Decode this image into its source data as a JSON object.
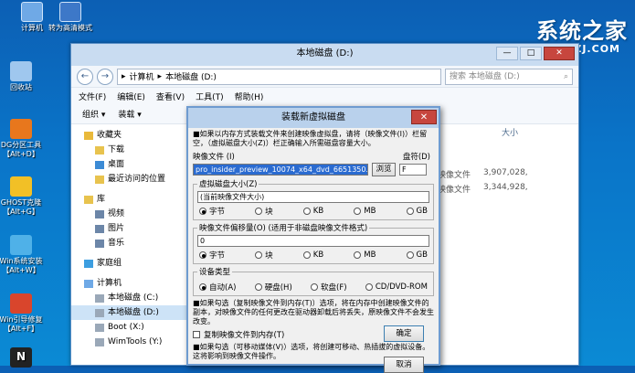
{
  "desktop": {
    "icons": [
      {
        "label": "计算机",
        "color": "#6fa9e6"
      },
      {
        "label": "转为高清模式",
        "color": "#3d78c8"
      },
      {
        "label": "回收站",
        "color": "#9fc7ee"
      },
      {
        "label": "DG分区工具",
        "label2": "【Alt+D】",
        "color": "#e8771d"
      },
      {
        "label": "GHOST克隆",
        "label2": "【Alt+G】",
        "color": "#f2c026"
      },
      {
        "label": "Win系统安装",
        "label2": "【Alt+W】",
        "color": "#4fb1e8"
      },
      {
        "label": "Win引导修复",
        "label2": "【Alt+F】",
        "color": "#d9452c"
      },
      {
        "label": "N",
        "color": "#222222"
      }
    ],
    "watermark": "系统之家",
    "watermark_sub": "KZJ.COM"
  },
  "explorer": {
    "title": "本地磁盘 (D:)",
    "min": "—",
    "max": "□",
    "close": "✕",
    "back": "←",
    "forward": "→",
    "path": [
      "计算机",
      "本地磁盘 (D:)"
    ],
    "sep": "▸",
    "search_placeholder": "搜索 本地磁盘 (D:)",
    "search_icon": "⌕",
    "menu": [
      "文件(F)",
      "编辑(E)",
      "查看(V)",
      "工具(T)",
      "帮助(H)"
    ],
    "toolbar": [
      "组织 ▾",
      "装载 ▾"
    ],
    "nav": [
      {
        "label": "收藏夹",
        "level": 0,
        "icon": "star-icon",
        "color": "#e9b93b"
      },
      {
        "label": "下载",
        "level": 1,
        "icon": "folder-icon",
        "color": "#e8c34e"
      },
      {
        "label": "桌面",
        "level": 1,
        "icon": "folder-icon",
        "color": "#3c8bd5"
      },
      {
        "label": "最近访问的位置",
        "level": 1,
        "icon": "folder-icon",
        "color": "#e8c34e"
      },
      {
        "label": "库",
        "level": 0,
        "icon": "library-icon",
        "color": "#e8c34e"
      },
      {
        "label": "视频",
        "level": 1,
        "icon": "video-icon",
        "color": "#6c86a8"
      },
      {
        "label": "图片",
        "level": 1,
        "icon": "picture-icon",
        "color": "#6c86a8"
      },
      {
        "label": "音乐",
        "level": 1,
        "icon": "music-icon",
        "color": "#6c86a8"
      },
      {
        "label": "家庭组",
        "level": 0,
        "icon": "homegroup-icon",
        "color": "#3d9ee0"
      },
      {
        "label": "计算机",
        "level": 0,
        "icon": "computer-icon",
        "color": "#6fa9e6"
      },
      {
        "label": "本地磁盘 (C:)",
        "level": 1,
        "icon": "drive-icon",
        "color": "#9aa8b8"
      },
      {
        "label": "本地磁盘 (D:)",
        "level": 1,
        "icon": "drive-icon",
        "color": "#9aa8b8",
        "selected": true
      },
      {
        "label": "Boot (X:)",
        "level": 1,
        "icon": "drive-icon",
        "color": "#9aa8b8"
      },
      {
        "label": "WimTools (Y:)",
        "level": 1,
        "icon": "drive-icon",
        "color": "#9aa8b8"
      }
    ],
    "col_size": "大小",
    "rows": [
      {
        "type": "映像文件",
        "size": "3,907,028,"
      },
      {
        "type": "映像文件",
        "size": "3,344,928,"
      }
    ]
  },
  "dialog": {
    "title": "装载新虚拟磁盘",
    "close": "✕",
    "note1": "■如果以内存方式装载文件来创建映像虚拟盘，请将（映像文件(I)）栏留空，（虚拟磁盘大小(Z)）栏正确输入所需磁盘容量大小。",
    "image_file_label": "映像文件 (I)",
    "drive_letter_label": "盘符(D)",
    "image_file_value": "pro_insider_preview_10074_x64_dvd_6651350.iso",
    "browse": "浏览",
    "drive_letter_value": "F",
    "vsize_legend": "虚拟磁盘大小(Z)",
    "vsize_value": "(当前映像文件大小)",
    "units": [
      "字节",
      "块",
      "KB",
      "MB",
      "GB"
    ],
    "vsize_selected": 0,
    "offset_legend": "映像文件偏移量(O) (适用于非磁盘映像文件格式)",
    "offset_value": "0",
    "offset_selected": 0,
    "dtype_legend": "设备类型",
    "dtypes": [
      "自动(A)",
      "硬盘(H)",
      "软盘(F)",
      "CD/DVD-ROM"
    ],
    "dtype_selected": 0,
    "note2": "■如果勾选（复制映像文件到内存(T)）选项，将在内存中创建映像文件的副本，对映像文件的任何更改在驱动器卸载后将丢失，原映像文件不会发生改变。",
    "copy_checkbox": "复制映像文件到内存(T)",
    "note3": "■如果勾选（可移动媒体(V)）选项，将创建可移动、热插拔的虚拟设备。这将影响到映像文件操作。",
    "ok": "确定",
    "cancel": "取消"
  }
}
